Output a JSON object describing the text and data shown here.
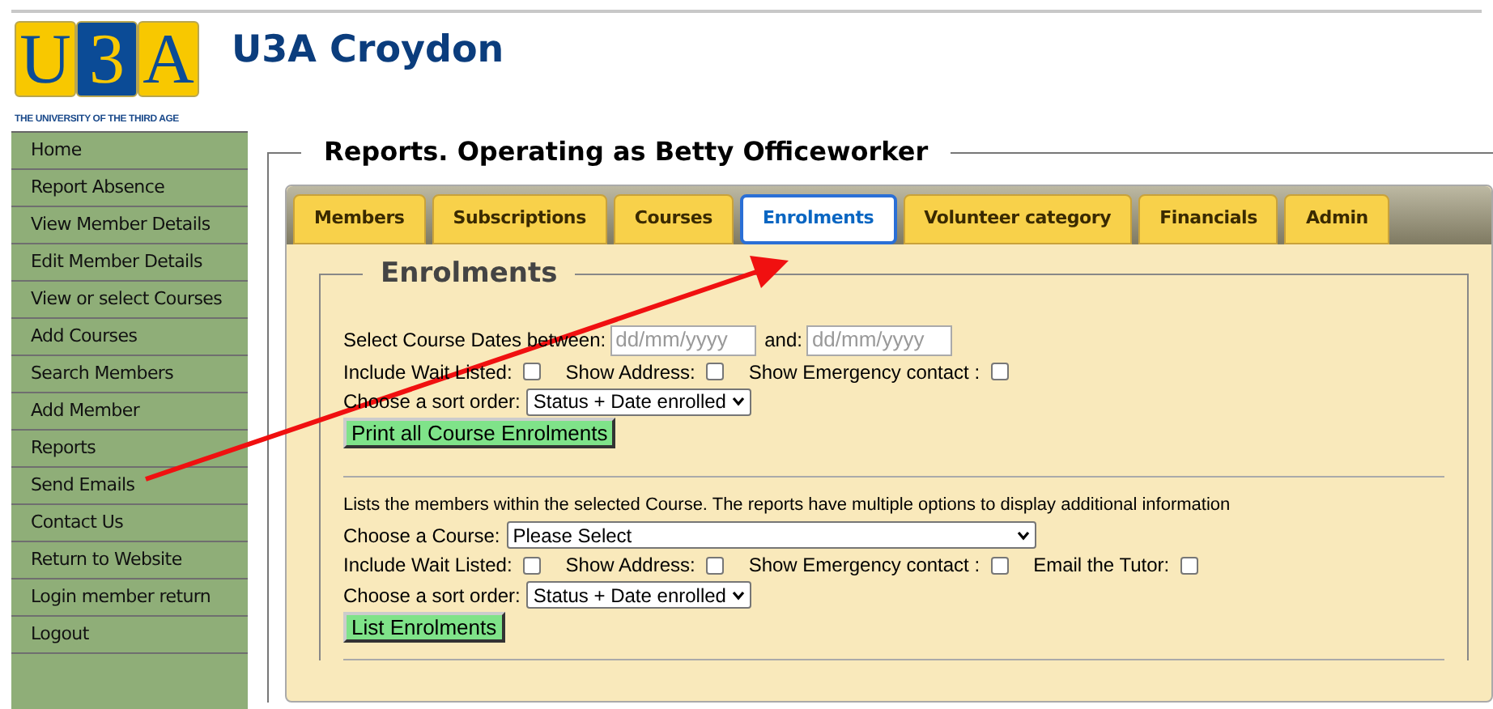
{
  "header": {
    "logo_letters": [
      "U",
      "3",
      "A"
    ],
    "tagline": "THE UNIVERSITY OF THE THIRD AGE",
    "title": "U3A Croydon"
  },
  "sidebar": {
    "items": [
      {
        "label": "Home"
      },
      {
        "label": "Report Absence"
      },
      {
        "label": "View Member Details"
      },
      {
        "label": "Edit Member Details"
      },
      {
        "label": "View or select Courses"
      },
      {
        "label": "Add Courses"
      },
      {
        "label": "Search Members"
      },
      {
        "label": "Add Member"
      },
      {
        "label": "Reports"
      },
      {
        "label": "Send Emails"
      },
      {
        "label": "Contact Us"
      },
      {
        "label": "Return to Website"
      },
      {
        "label": "Login member return"
      },
      {
        "label": "Logout"
      }
    ]
  },
  "page_heading": "Reports. Operating as Betty Officeworker",
  "tabs": [
    {
      "label": "Members",
      "selected": false
    },
    {
      "label": "Subscriptions",
      "selected": false
    },
    {
      "label": "Courses",
      "selected": false
    },
    {
      "label": "Enrolments",
      "selected": true
    },
    {
      "label": "Volunteer category",
      "selected": false
    },
    {
      "label": "Financials",
      "selected": false
    },
    {
      "label": "Admin",
      "selected": false
    }
  ],
  "section_title": "Enrolments",
  "date_form": {
    "dates_label": "Select Course Dates between:",
    "from": {
      "placeholder": "dd/mm/yyyy"
    },
    "and_label": "and:",
    "to": {
      "placeholder": "dd/mm/yyyy"
    },
    "options": [
      {
        "label": "Include Wait Listed:",
        "checked": false
      },
      {
        "label": "Show Address:",
        "checked": false
      },
      {
        "label": "Show Emergency contact :",
        "checked": false
      }
    ],
    "sort": {
      "label": "Choose a sort order:",
      "value": "Status + Date enrolled"
    },
    "button": "Print all Course Enrolments"
  },
  "course_form": {
    "description": "Lists the members within the selected Course. The reports have multiple options to display additional information",
    "course": {
      "label": "Choose a Course:",
      "value": "Please Select"
    },
    "options": [
      {
        "label": "Include Wait Listed:",
        "checked": false
      },
      {
        "label": "Show Address:",
        "checked": false
      },
      {
        "label": "Show Emergency contact :",
        "checked": false
      },
      {
        "label": "Email the Tutor:",
        "checked": false
      }
    ],
    "sort": {
      "label": "Choose a sort order:",
      "value": "Status + Date enrolled"
    },
    "button": "List Enrolments"
  }
}
